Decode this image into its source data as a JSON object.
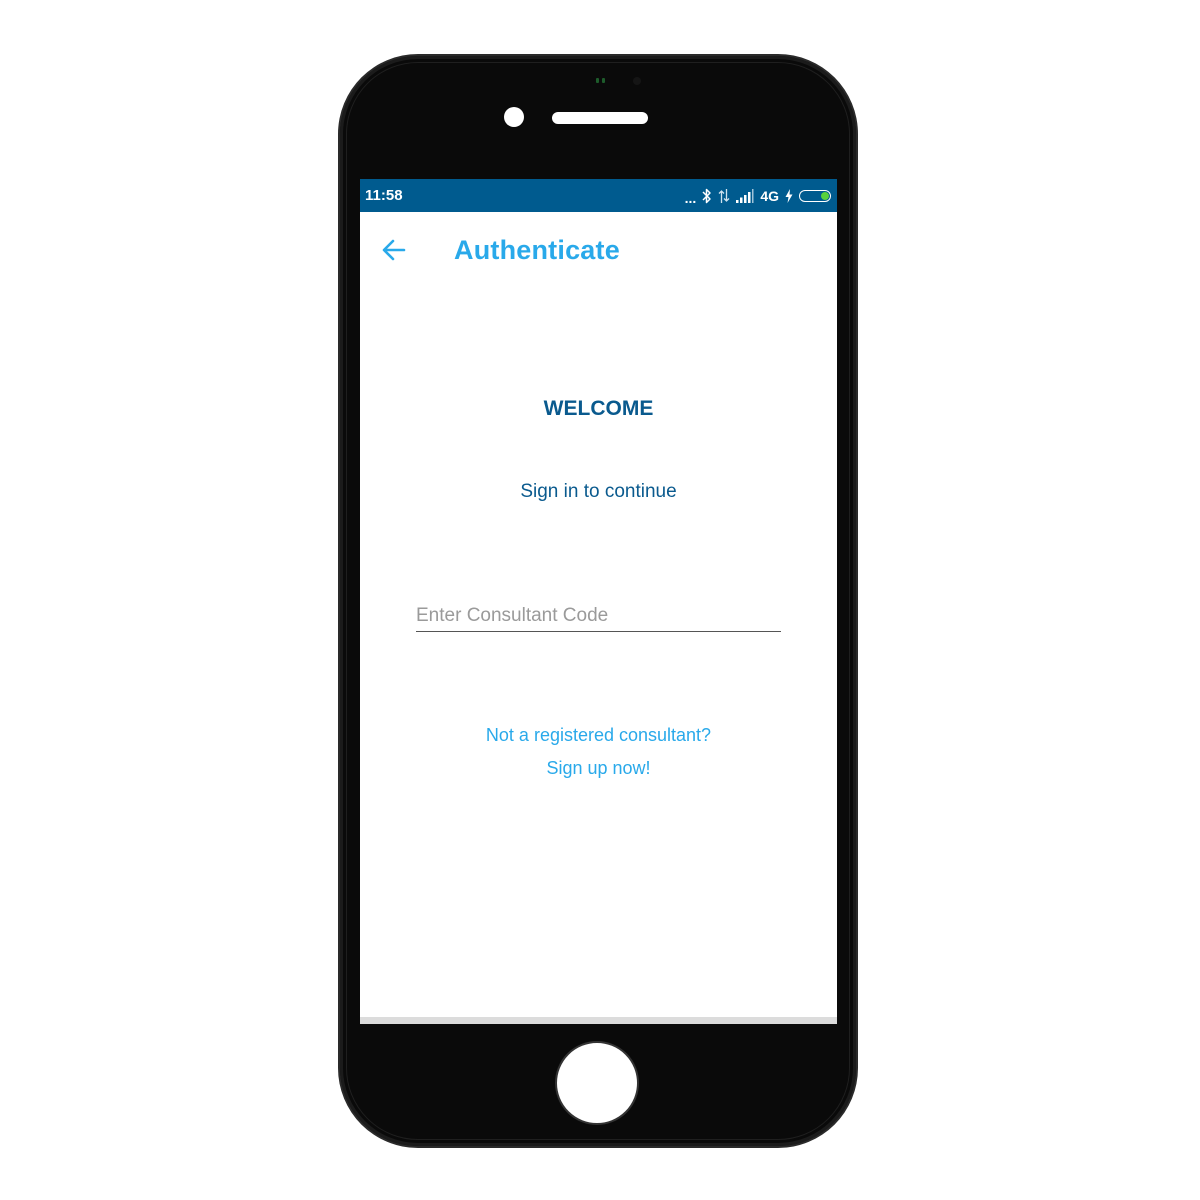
{
  "status_bar": {
    "time": "11:58",
    "overflow_dots": "...",
    "network": "4G",
    "icons": [
      "bluetooth-icon",
      "data-transfer-icon",
      "signal-icon",
      "charging-icon",
      "battery-icon"
    ],
    "battery_level": 0.35,
    "background_color": "#005b8f",
    "battery_color": "#58d13c"
  },
  "app_bar": {
    "title": "Authenticate",
    "back_icon": "arrow-left-icon",
    "accent_color": "#29a9ea"
  },
  "main": {
    "welcome": "WELCOME",
    "subtitle": "Sign in to continue",
    "consultant_code": {
      "placeholder": "Enter Consultant Code",
      "value": ""
    },
    "signup_question": "Not a registered consultant?",
    "signup_link": "Sign up now!",
    "primary_color": "#0a5a8e"
  }
}
